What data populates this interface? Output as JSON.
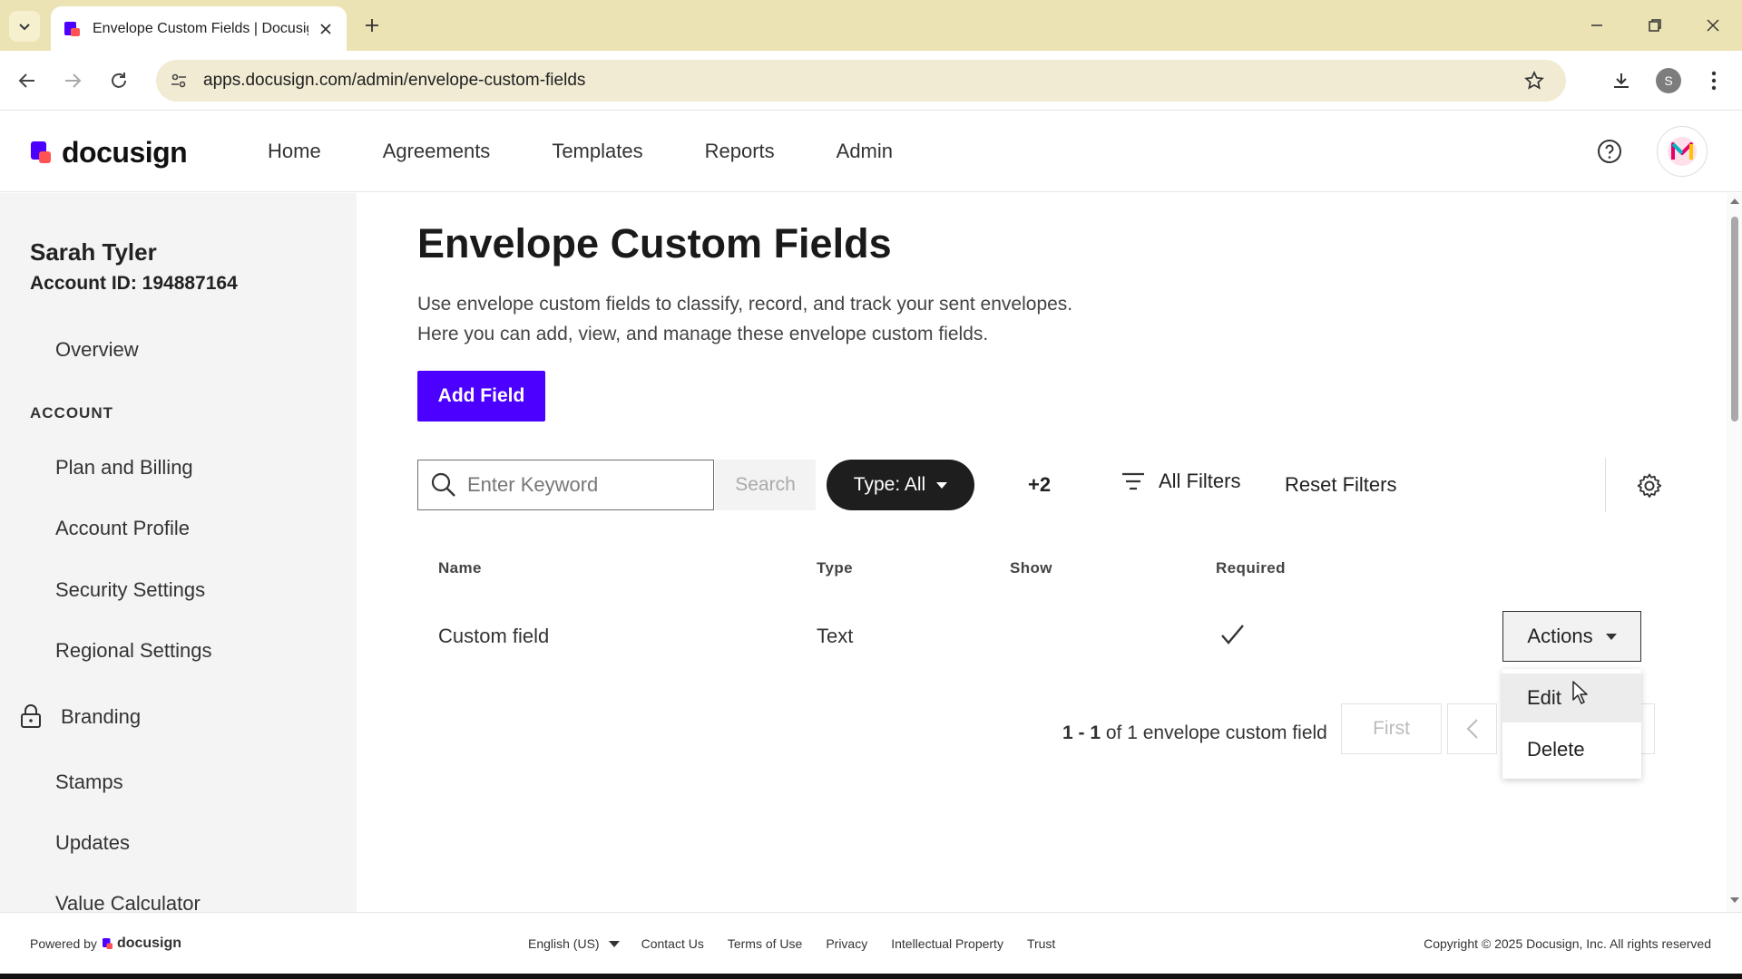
{
  "browser": {
    "tab_title": "Envelope Custom Fields | Docusign",
    "url": "apps.docusign.com/admin/envelope-custom-fields",
    "profile_initial": "S"
  },
  "header": {
    "logo_text": "docusign",
    "nav": [
      "Home",
      "Agreements",
      "Templates",
      "Reports",
      "Admin"
    ]
  },
  "sidebar": {
    "user_name": "Sarah Tyler",
    "account_id": "Account ID: 194887164",
    "overview": "Overview",
    "section": "ACCOUNT",
    "items": [
      "Plan and Billing",
      "Account Profile",
      "Security Settings",
      "Regional Settings",
      "Branding",
      "Stamps",
      "Updates",
      "Value Calculator"
    ]
  },
  "main": {
    "title": "Envelope Custom Fields",
    "desc_line1": "Use envelope custom fields to classify, record, and track your sent envelopes.",
    "desc_line2": "Here you can add, view, and manage these envelope custom fields.",
    "add_field_label": "Add Field",
    "search_placeholder": "Enter Keyword",
    "search_label": "Search",
    "type_filter": "Type: All",
    "more_filters": "+2",
    "all_filters": "All Filters",
    "reset_filters": "Reset Filters"
  },
  "table": {
    "headers": [
      "Name",
      "Type",
      "Show",
      "Required"
    ],
    "rows": [
      {
        "name": "Custom field",
        "type": "Text",
        "show": "",
        "required": true
      }
    ],
    "actions_label": "Actions",
    "menu": [
      "Edit",
      "Delete"
    ]
  },
  "pagination": {
    "range": "1 - 1",
    "text": "of 1 envelope custom field",
    "first": "First"
  },
  "footer": {
    "powered_by": "Powered by",
    "logo_text": "docusign",
    "language": "English (US)",
    "links": [
      "Contact Us",
      "Terms of Use",
      "Privacy",
      "Intellectual Property",
      "Trust"
    ],
    "copyright": "Copyright © 2025 Docusign, Inc. All rights reserved"
  },
  "colors": {
    "brand_purple": "#4c00ff",
    "chrome_tabstrip": "#ece3b4",
    "filter_pill": "#1e1e1e"
  }
}
